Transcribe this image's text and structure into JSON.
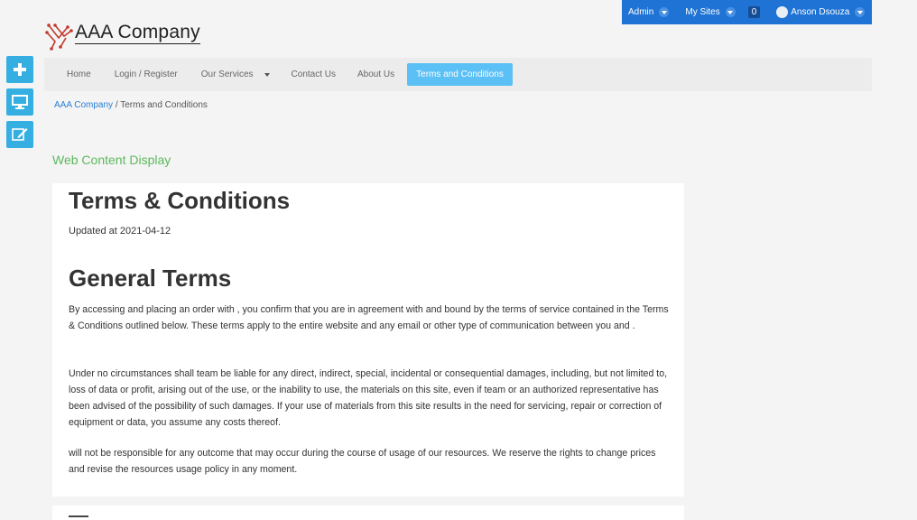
{
  "dockbar": {
    "admin_label": "Admin",
    "my_sites_label": "My Sites",
    "notification_count": "0",
    "user_name": "Anson Dsouza"
  },
  "logo": {
    "text": "AAA Company"
  },
  "sidebar": {
    "buttons": [
      {
        "icon": "plus-icon"
      },
      {
        "icon": "monitor-icon"
      },
      {
        "icon": "edit-icon"
      }
    ]
  },
  "nav": {
    "items": [
      "Home",
      "Login / Register",
      "Our Services",
      "Contact Us",
      "About Us"
    ],
    "active": "Terms and Conditions"
  },
  "breadcrumb": {
    "home": "AAA Company",
    "separator": "/",
    "current": "Terms and Conditions"
  },
  "portlet_title": "Web Content Display",
  "content": {
    "title": "Terms & Conditions",
    "updated": "Updated at 2021-04-12",
    "section_title": "General Terms",
    "paragraphs": [
      "By accessing and placing an order with , you confirm that you are in agreement with and bound by the terms of service contained in the Terms & Conditions outlined below. These terms apply to the entire website and any email or other type of communication between you and .",
      "Under no circumstances shall team be liable for any direct, indirect, special, incidental or consequential damages, including, but not limited to, loss of data or profit, arising out of the use, or the inability to use, the materials on this site, even if team or an authorized representative has been advised of the possibility of such damages. If your use of materials from this site results in the need for servicing, repair or correction of equipment or data, you assume any costs thereof.",
      "will not be responsible for any outcome that may occur during the course of usage of our resources. We reserve the rights to change prices and revise the resources usage policy in any moment."
    ]
  },
  "colors": {
    "dockbar": "#1e73d4",
    "sidebar_button": "#35aee2",
    "nav_active": "#5bc0f5",
    "portlet_title": "#5cb85c",
    "link": "#2a7fd4"
  }
}
